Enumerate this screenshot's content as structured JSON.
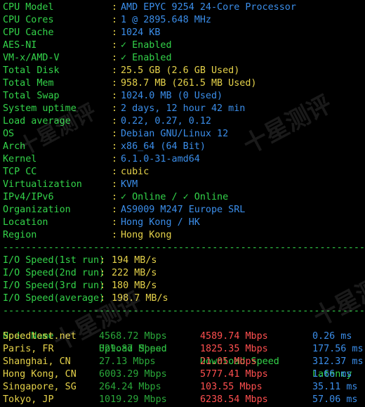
{
  "sysinfo": [
    {
      "key": "CPU Model",
      "value": "AMD EPYC 9254 24-Core Processor",
      "color": "b"
    },
    {
      "key": "CPU Cores",
      "value": "1 @ 2895.648 MHz",
      "color": "b"
    },
    {
      "key": "CPU Cache",
      "value": "1024 KB",
      "color": "b"
    },
    {
      "key": "AES-NI",
      "value": "✓ Enabled",
      "color": "g"
    },
    {
      "key": "VM-x/AMD-V",
      "value": "✓ Enabled",
      "color": "g"
    },
    {
      "key": "Total Disk",
      "value": "25.5 GB (2.6 GB Used)",
      "color": "y"
    },
    {
      "key": "Total Mem",
      "value": "958.7 MB (261.5 MB Used)",
      "color": "y"
    },
    {
      "key": "Total Swap",
      "value": "1024.0 MB (0 Used)",
      "color": "b"
    },
    {
      "key": "System uptime",
      "value": "2 days, 12 hour 42 min",
      "color": "b"
    },
    {
      "key": "Load average",
      "value": "0.22, 0.27, 0.12",
      "color": "b"
    },
    {
      "key": "OS",
      "value": "Debian GNU/Linux 12",
      "color": "b"
    },
    {
      "key": "Arch",
      "value": "x86_64 (64 Bit)",
      "color": "b"
    },
    {
      "key": "Kernel",
      "value": "6.1.0-31-amd64",
      "color": "b"
    },
    {
      "key": "TCP CC",
      "value": "cubic",
      "color": "y"
    },
    {
      "key": "Virtualization",
      "value": "KVM",
      "color": "b"
    },
    {
      "key": "IPv4/IPv6",
      "value": "✓ Online / ✓ Online",
      "color": "g"
    },
    {
      "key": "Organization",
      "value": "AS9009 M247 Europe SRL",
      "color": "b"
    },
    {
      "key": "Location",
      "value": "Hong Kong / HK",
      "color": "b"
    },
    {
      "key": "Region",
      "value": "Hong Kong",
      "color": "y"
    }
  ],
  "separator": ":",
  "io": [
    {
      "key": "I/O Speed(1st run)",
      "value": "194 MB/s"
    },
    {
      "key": "I/O Speed(2nd run)",
      "value": "222 MB/s"
    },
    {
      "key": "I/O Speed(3rd run)",
      "value": "180 MB/s"
    },
    {
      "key": "I/O Speed(average)",
      "value": "198.7 MB/s"
    }
  ],
  "speedtest": {
    "headers": [
      "Node Name",
      "Upload Speed",
      "Download Speed",
      "Latency"
    ],
    "rows": [
      {
        "node": "Speedtest.net",
        "upload": "4568.72 Mbps",
        "download": "4589.74 Mbps",
        "latency": "0.26 ms"
      },
      {
        "node": "Paris, FR",
        "upload": "329.87 Mbps",
        "download": "1825.35 Mbps",
        "latency": "177.56 ms"
      },
      {
        "node": "Shanghai, CN",
        "upload": "27.13 Mbps",
        "download": "21.05 Mbps",
        "latency": "312.37 ms"
      },
      {
        "node": "Hong Kong, CN",
        "upload": "6003.29 Mbps",
        "download": "5777.41 Mbps",
        "latency": "1.66 ms"
      },
      {
        "node": "Singapore, SG",
        "upload": "264.24 Mbps",
        "download": "103.55 Mbps",
        "latency": "35.11 ms"
      },
      {
        "node": "Tokyo, JP",
        "upload": "1019.29 Mbps",
        "download": "6238.54 Mbps",
        "latency": "57.06 ms"
      }
    ]
  },
  "watermark": "十星测评",
  "colors": {
    "green": "#33d44a",
    "blue": "#3b8eea",
    "yellow": "#e5d24a",
    "red": "#ff4f4f",
    "upload_green": "#2aa83a"
  }
}
